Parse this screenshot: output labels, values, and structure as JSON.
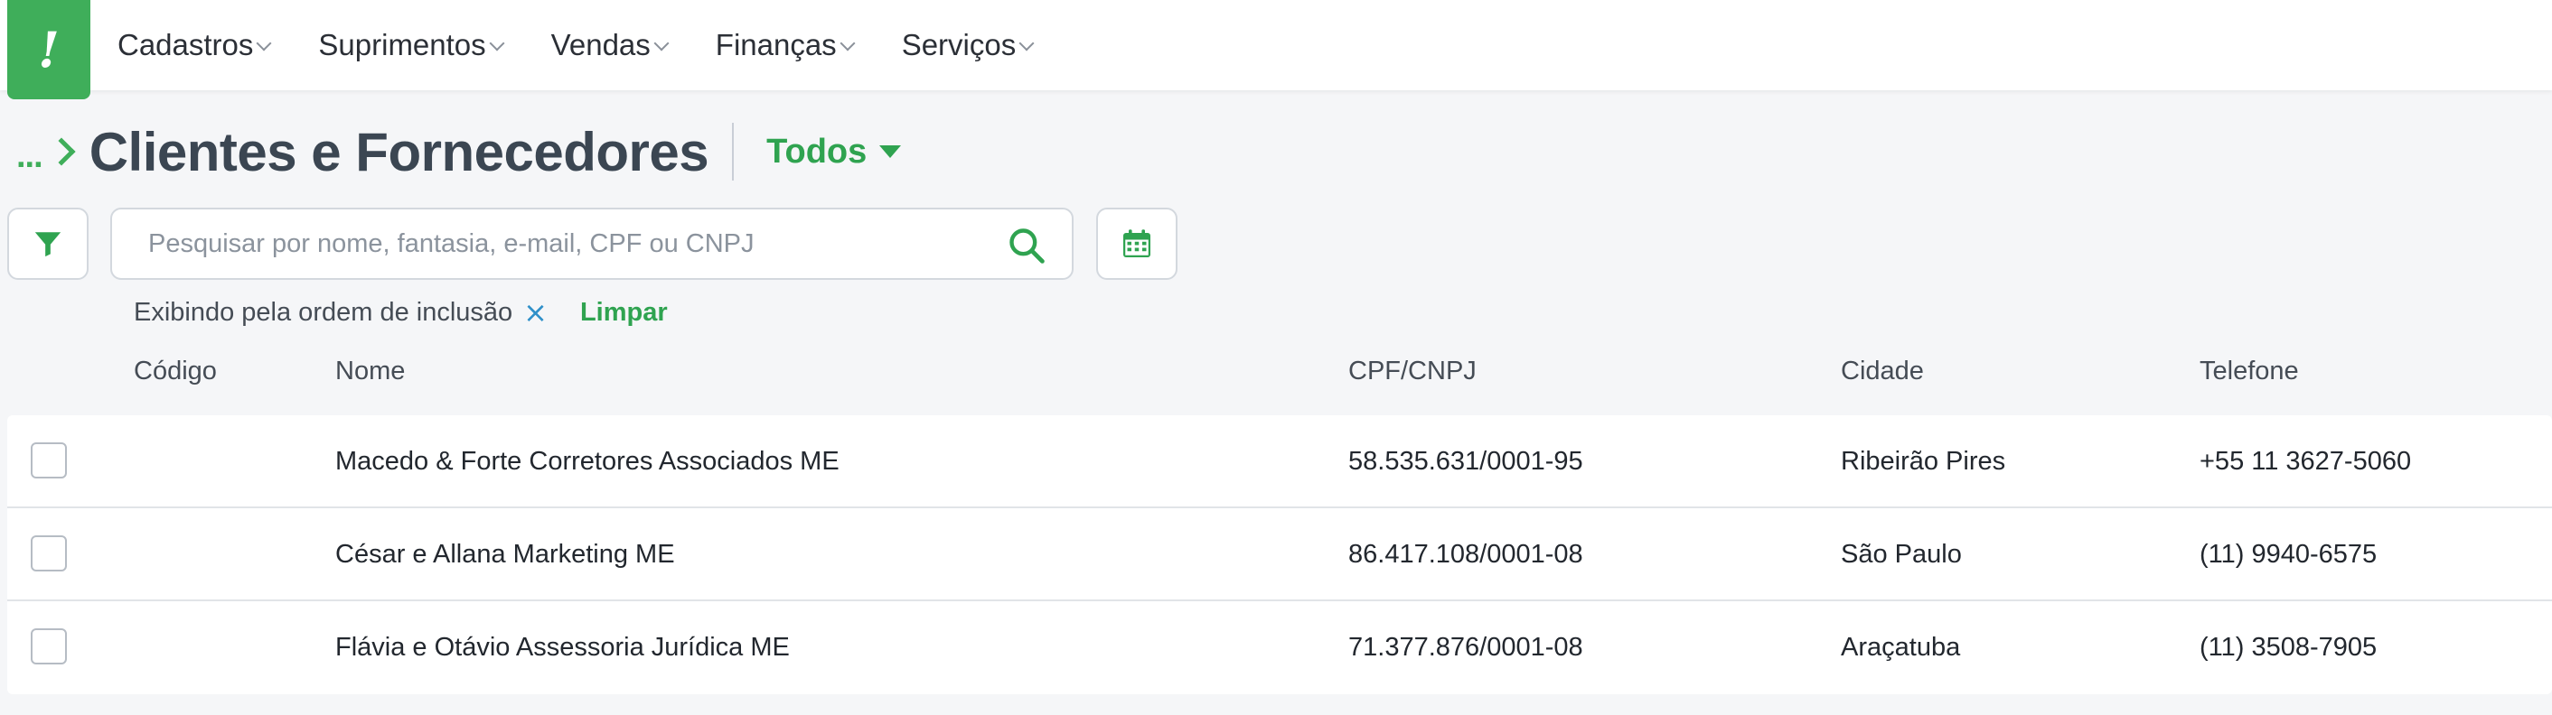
{
  "logo": {
    "glyph": "!"
  },
  "nav": {
    "items": [
      {
        "label": "Cadastros"
      },
      {
        "label": "Suprimentos"
      },
      {
        "label": "Vendas"
      },
      {
        "label": "Finanças"
      },
      {
        "label": "Serviços"
      }
    ]
  },
  "breadcrumb": {
    "ellipsis": "..."
  },
  "page": {
    "title": "Clientes e Fornecedores",
    "filter_dropdown": "Todos"
  },
  "search": {
    "placeholder": "Pesquisar por nome, fantasia, e-mail, CPF ou CNPJ",
    "value": ""
  },
  "sort": {
    "text": "Exibindo pela ordem de inclusão",
    "clear_icon": "×",
    "clear_label": "Limpar"
  },
  "table": {
    "columns": [
      "Código",
      "Nome",
      "CPF/CNPJ",
      "Cidade",
      "Telefone"
    ],
    "rows": [
      {
        "codigo": "",
        "nome": "Macedo & Forte Corretores Associados ME",
        "cpf_cnpj": "58.535.631/0001-95",
        "cidade": "Ribeirão Pires",
        "telefone": "+55 11 3627-5060"
      },
      {
        "codigo": "",
        "nome": "César e Allana Marketing ME",
        "cpf_cnpj": "86.417.108/0001-08",
        "cidade": "São Paulo",
        "telefone": "(11) 9940-6575"
      },
      {
        "codigo": "",
        "nome": "Flávia e Otávio Assessoria Jurídica ME",
        "cpf_cnpj": "71.377.876/0001-08",
        "cidade": "Araçatuba",
        "telefone": "(11) 3508-7905"
      }
    ]
  },
  "colors": {
    "accent": "#3fae5a",
    "link_blue": "#2f90c9",
    "title": "#3b4652"
  },
  "icons": {
    "filter": "filter-icon",
    "search": "search-icon",
    "calendar": "calendar-icon"
  }
}
